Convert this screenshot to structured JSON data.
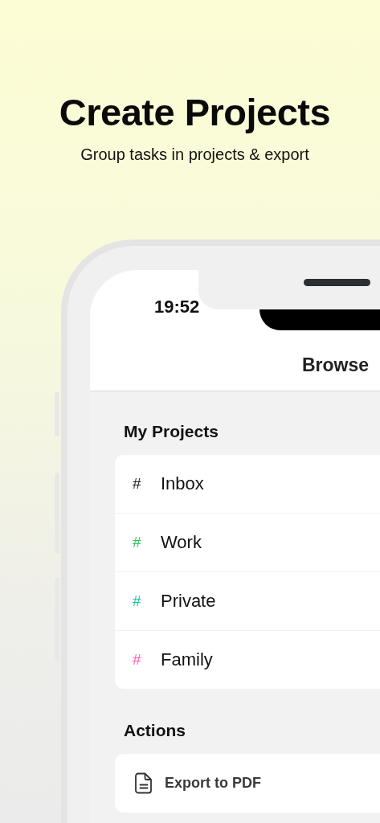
{
  "headline": {
    "title": "Create Projects",
    "subtitle": "Group tasks in projects & export"
  },
  "status_bar": {
    "time": "19:52"
  },
  "nav_bar": {
    "title": "Browse"
  },
  "sections": [
    {
      "title": "My Projects",
      "items": [
        {
          "kind": "project",
          "symbol": "#",
          "label": "Inbox",
          "color": "#1c1c1e"
        },
        {
          "kind": "project",
          "symbol": "#",
          "label": "Work",
          "color": "#34c759"
        },
        {
          "kind": "project",
          "symbol": "#",
          "label": "Private",
          "color": "#1cc39c"
        },
        {
          "kind": "project",
          "symbol": "#",
          "label": "Family",
          "color": "#ff5fa8"
        }
      ]
    },
    {
      "title": "Actions",
      "items": [
        {
          "kind": "action",
          "label": "Export to PDF"
        }
      ]
    }
  ]
}
